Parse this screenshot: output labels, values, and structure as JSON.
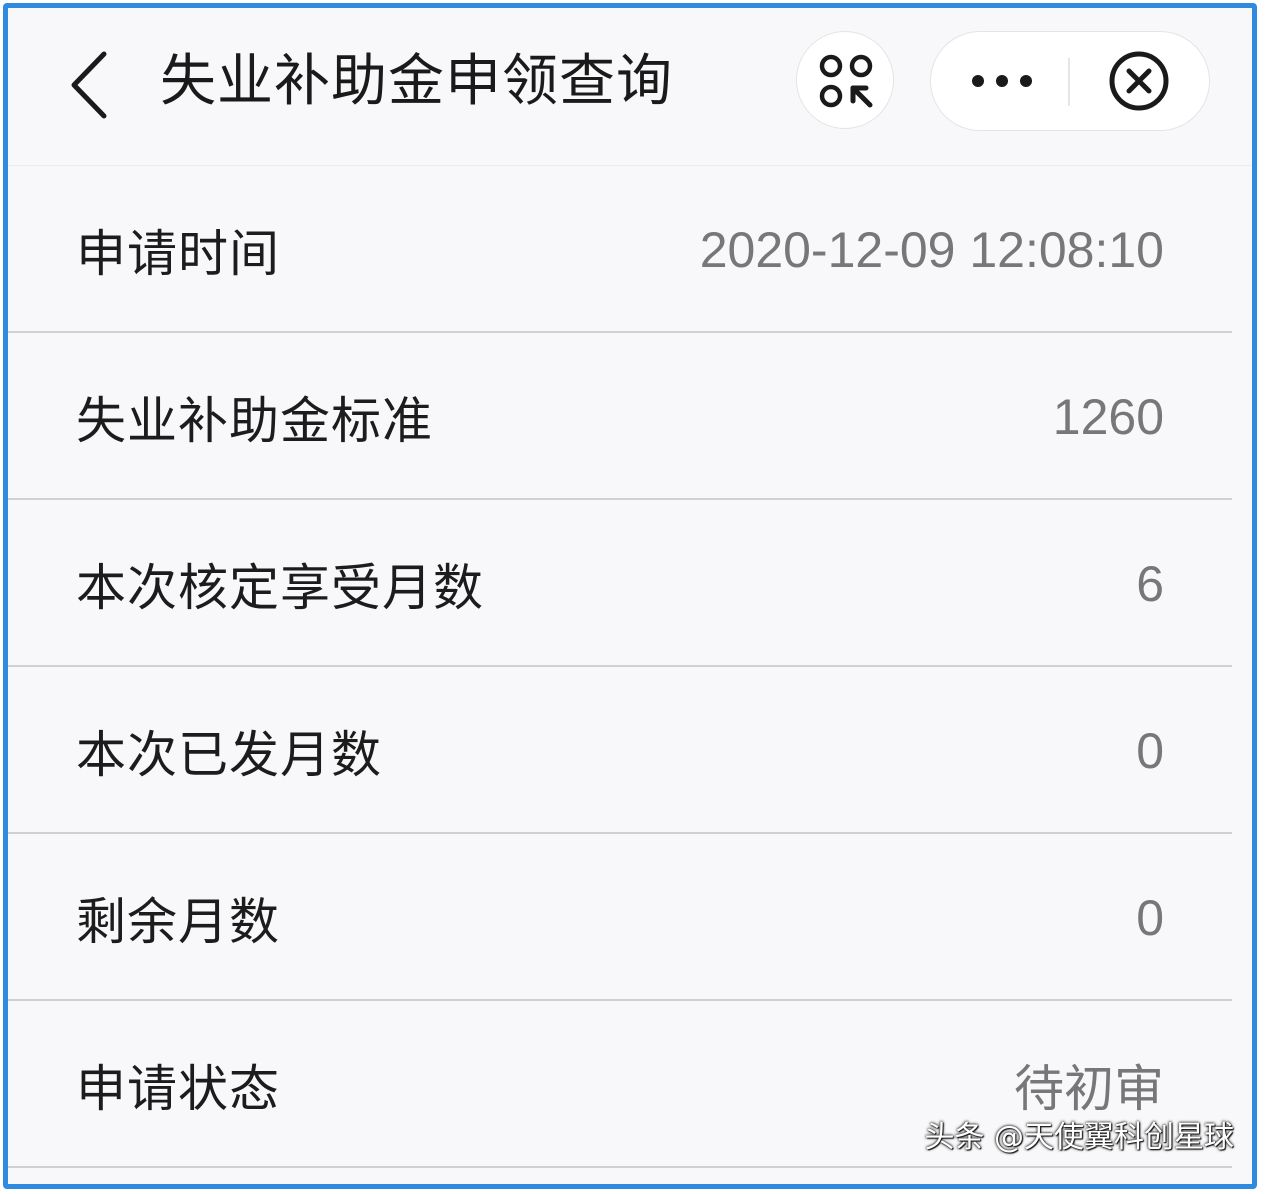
{
  "header": {
    "title": "失业补助金申领查询",
    "back_icon": "chevron-left-icon",
    "scan_icon": "scan-qr-icon",
    "more_icon": "more-dots-icon",
    "close_icon": "close-circle-icon"
  },
  "rows": [
    {
      "label": "申请时间",
      "value": "2020-12-09 12:08:10"
    },
    {
      "label": "失业补助金标准",
      "value": "1260"
    },
    {
      "label": "本次核定享受月数",
      "value": "6"
    },
    {
      "label": "本次已发月数",
      "value": "0"
    },
    {
      "label": "剩余月数",
      "value": "0"
    },
    {
      "label": "申请状态",
      "value": "待初审"
    }
  ],
  "watermark": "头条 @天使翼科创星球",
  "colors": {
    "frame_border": "#2e8be0",
    "background": "#f8f8fa",
    "label_text": "#1c1c1c",
    "value_text": "#777779",
    "divider": "#cfcfd4"
  }
}
